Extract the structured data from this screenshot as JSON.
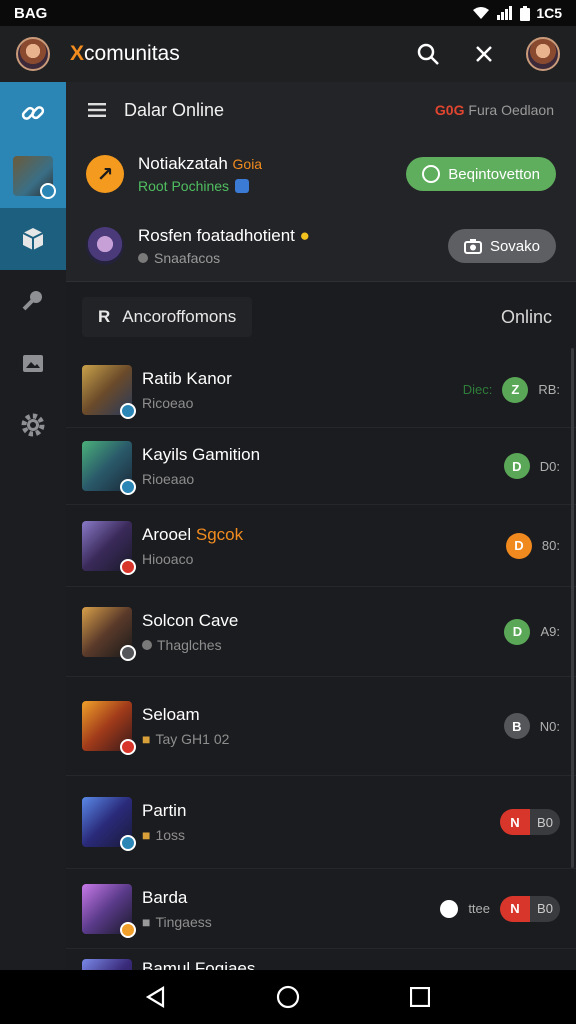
{
  "status_bar": {
    "time": "BAG",
    "battery_text": "1C5"
  },
  "header": {
    "title_prefix": "X",
    "title_rest": "comunitas"
  },
  "panel": {
    "title": "Dalar Online",
    "meta_highlight": "G0G",
    "meta_rest": "Fura Oedlaon",
    "rows": [
      {
        "name": "Notiakzatah",
        "tag": "Goia",
        "sub": "Root Pochines",
        "action": "Beqintovetton"
      },
      {
        "name": "Rosfen foatadhotient",
        "sub": "Snaafacos",
        "action": "Sovako"
      }
    ]
  },
  "section": {
    "sort_letter": "R",
    "sort_label": "Ancoroffomons",
    "right_label": "Onlinc"
  },
  "list": [
    {
      "name": "Ratib Kanor",
      "sub": "Ricoeao",
      "mini": "Diec:",
      "dot": "Z",
      "value": "RB:"
    },
    {
      "name": "Kayils Gamition",
      "sub": "Rioeaao",
      "dot": "D",
      "value": "D0:"
    },
    {
      "name_plain": "Arooel ",
      "name_accent": "Sgcok",
      "sub": "Hiooaco",
      "dot": "D",
      "value": "80:"
    },
    {
      "name": "Solcon Cave",
      "sub": "Thaglches",
      "dot": "D",
      "value": "A9:"
    },
    {
      "name": "Seloam",
      "sub": "Tay GH1 02",
      "dot": "B",
      "value": "N0:"
    },
    {
      "name": "Partin",
      "sub": "1oss",
      "pill_left": "N",
      "pill_right": "B0"
    },
    {
      "name": "Barda",
      "sub": "Tingaess",
      "mini": "ttee",
      "pill_left": "N",
      "pill_right": "B0"
    },
    {
      "name": "Bamul Foqiaes"
    }
  ],
  "colors": {
    "accent_orange": "#f28c1e",
    "rail_active": "#2b86b5",
    "green_status": "#5aa857",
    "orange_status": "#f0891e",
    "red_status": "#d9362b",
    "grey_status": "#55565a"
  },
  "icons": {
    "header": [
      "search-icon",
      "close-icon"
    ],
    "rail": [
      "link-icon",
      "game-thumbnail",
      "cube-icon",
      "key-icon",
      "gallery-icon",
      "gear-icon"
    ],
    "nav": [
      "back-icon",
      "home-icon",
      "recents-icon"
    ]
  }
}
